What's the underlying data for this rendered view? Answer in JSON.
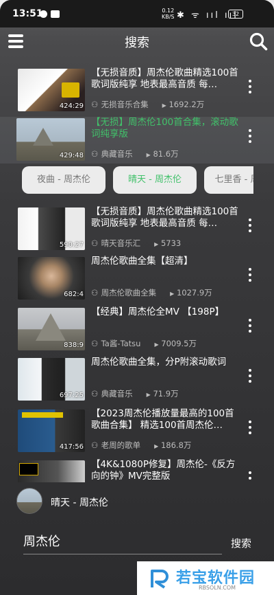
{
  "status_bar": {
    "time": "13:51",
    "net_speed_value": "0.12",
    "net_speed_unit": "KB/S",
    "signal_icons": "✱ ᯤ ııl ııl",
    "battery": "32"
  },
  "header": {
    "title": "搜索",
    "menu_icon": "hamburger-icon",
    "search_icon": "search-icon"
  },
  "results": [
    {
      "title": "【无损音质】周杰伦歌曲精选100首 歌词版纯享 地表最高音质 每…",
      "channel": "无损音乐合集",
      "views": "1692.2万",
      "duration": "424:29"
    },
    {
      "title": "【无损】周杰伦100首合集，滚动歌词纯享版",
      "channel": "典藏音乐",
      "views": "81.6万",
      "duration": "429:48",
      "highlighted": true
    }
  ],
  "chips": [
    {
      "label": "夜曲 - 周杰伦"
    },
    {
      "label": "晴天 - 周杰伦",
      "active": true
    },
    {
      "label": "七里香 - 周杰伦"
    }
  ],
  "results2": [
    {
      "title": "【无损音质】周杰伦歌曲精选100首 歌词版纯享 地表最高音质 每…",
      "channel": "晴天音乐汇",
      "views": "5733",
      "duration": "590:27"
    },
    {
      "title": "周杰伦歌曲全集【超清】",
      "channel": "周杰伦歌曲全集",
      "views": "1027.9万",
      "duration": "682:4"
    },
    {
      "title": "【经典】周杰伦全MV 【198P】",
      "channel": "Ta酱-Tatsu",
      "views": "7009.5万",
      "duration": "838:9"
    },
    {
      "title": "周杰伦歌曲全集，分P附滚动歌词",
      "channel": "典藏音乐",
      "views": "71.9万",
      "duration": "697:25"
    },
    {
      "title": "【2023周杰伦播放量最高的100首歌曲合集】 精选100首周杰伦…",
      "channel": "老周的歌单",
      "views": "186.8万",
      "duration": "417:56"
    },
    {
      "title": "【4K&1080P修复】周杰伦-《反方向的钟》MV完整版",
      "channel": "",
      "views": "",
      "duration": ""
    }
  ],
  "player": {
    "song": "晴天 - 周杰伦"
  },
  "bottom_search": {
    "query": "周杰伦",
    "button": "搜索"
  },
  "watermark": {
    "text": "若宝软件园",
    "url": "RBSOLN.COM"
  },
  "colors": {
    "accent_green": "#41c16a",
    "chip_bg": "#ececec",
    "bg_dark": "#2c2c2e"
  }
}
